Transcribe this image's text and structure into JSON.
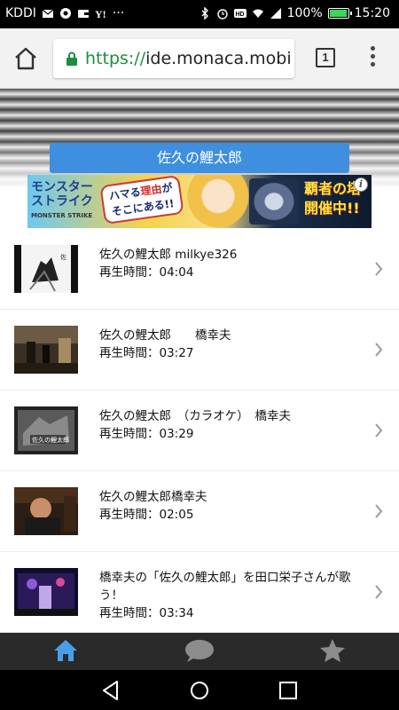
{
  "status_bar": {
    "carrier": "KDDI",
    "battery_percent": "100%",
    "battery_level": 1.0,
    "time": "15:20",
    "icons": [
      "mail-icon",
      "chrome-icon",
      "wallet-icon",
      "yahoo-icon",
      "more-notifications-icon",
      "bluetooth-icon",
      "alarm-icon",
      "hd-icon",
      "wifi-icon",
      "signal-icon",
      "battery-icon"
    ],
    "overflow": "···"
  },
  "browser": {
    "url_scheme": "https://",
    "url_host": "ide.monaca.mobi",
    "tab_count": "1",
    "icons": [
      "home-icon",
      "lock-icon",
      "menu-icon"
    ]
  },
  "page": {
    "title": "佐久の鯉太郎"
  },
  "banner": {
    "logo_title": "モンスター\nストライク",
    "logo_subtitle": "MONSTER STRIKE",
    "catchphrase": "ハマる理由が\nそこにある!!",
    "event_text": "覇者の塔\n開催中!!",
    "info_label": "i"
  },
  "videos": [
    {
      "title": "佐久の鯉太郎 milkye326",
      "duration_label": "再生時間：04:04"
    },
    {
      "title": "佐久の鯉太郎　　橋幸夫",
      "duration_label": "再生時間：03:27"
    },
    {
      "title": "佐久の鯉太郎　（カラオケ）　橋幸夫",
      "duration_label": "再生時間：03:29"
    },
    {
      "title": "佐久の鯉太郎橋幸夫",
      "duration_label": "再生時間：02:05"
    },
    {
      "title": "橋幸夫の「佐久の鯉太郎」を田口栄子さんが歌う！",
      "duration_label": "再生時間：03:34"
    }
  ],
  "thumb_caption": "佐久の鯉太郎",
  "tab_bar": {
    "tabs": [
      "home-tab",
      "comment-tab",
      "favorite-tab"
    ],
    "active": "home-tab",
    "active_color": "#4a9ee8",
    "inactive_color": "#8c8c8c"
  },
  "nav": [
    "back",
    "home",
    "recents"
  ]
}
